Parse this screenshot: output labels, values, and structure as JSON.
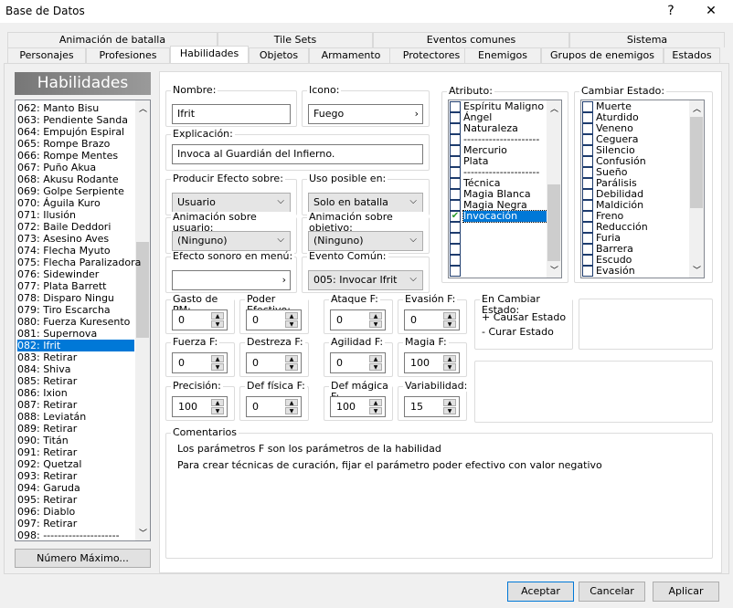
{
  "window": {
    "title": "Base de Datos",
    "help": "?",
    "close": "✕"
  },
  "tabs_row1": [
    "Animación de batalla",
    "Tile Sets",
    "Eventos comunes",
    "Sistema"
  ],
  "tabs_row2": [
    "Personajes",
    "Profesiones",
    "Habilidades",
    "Objetos",
    "Armamento",
    "Protectores",
    "Enemigos",
    "Grupos de enemigos",
    "Estados"
  ],
  "active_tab": "Habilidades",
  "sidebar": {
    "header": "Habilidades",
    "selected": "082: Ifrit",
    "max_button": "Número Máximo...",
    "items": [
      "062: Manto Bisu",
      "063: Pendiente Sanda",
      "064: Empujón Espiral",
      "065: Rompe Brazo",
      "066: Rompe Mentes",
      "067: Puño Akua",
      "068: Akusu Rodante",
      "069: Golpe Serpiente",
      "070: Águila Kuro",
      "071: Ilusión",
      "072: Baile Deddori",
      "073: Asesino Aves",
      "074: Flecha Myuto",
      "075: Flecha Paralizadora",
      "076: Sidewinder",
      "077: Plata Barrett",
      "078: Disparo Ningu",
      "079: Tiro Escarcha",
      "080: Fuerza Kuresento",
      "081: Supernova",
      "082: Ifrit",
      "083: Retirar",
      "084: Shiva",
      "085: Retirar",
      "086: Ixion",
      "087: Retirar",
      "088: Leviatán",
      "089: Retirar",
      "090: Titán",
      "091: Retirar",
      "092: Quetzal",
      "093: Retirar",
      "094: Garuda",
      "095: Retirar",
      "096: Diablo",
      "097: Retirar",
      "098: ---------------------"
    ]
  },
  "form": {
    "nombre": {
      "label": "Nombre:",
      "value": "Ifrit"
    },
    "icono": {
      "label": "Icono:",
      "value": "Fuego"
    },
    "explicacion": {
      "label": "Explicación:",
      "value": "Invoca al Guardián del Infierno."
    },
    "producir": {
      "label": "Producir Efecto sobre:",
      "value": "Usuario"
    },
    "uso": {
      "label": "Uso posible en:",
      "value": "Solo en batalla"
    },
    "anim_usuario": {
      "label": "Animación sobre usuario:",
      "value": "(Ninguno)"
    },
    "anim_objetivo": {
      "label": "Animación sobre objetivo:",
      "value": "(Ninguno)"
    },
    "efecto_sonoro": {
      "label": "Efecto sonoro en menú:",
      "value": ""
    },
    "evento_comun": {
      "label": "Evento Común:",
      "value": "005: Invocar Ifrit"
    },
    "spinners": [
      {
        "label": "Gasto de PM:",
        "value": "0"
      },
      {
        "label": "Poder Efectivo:",
        "value": "0"
      },
      {
        "label": "Ataque F:",
        "value": "0"
      },
      {
        "label": "Evasión F:",
        "value": "0"
      },
      {
        "label": "Fuerza F:",
        "value": "0"
      },
      {
        "label": "Destreza F:",
        "value": "0"
      },
      {
        "label": "Agilidad F:",
        "value": "0"
      },
      {
        "label": "Magia F:",
        "value": "100"
      },
      {
        "label": "Precisión:",
        "value": "100"
      },
      {
        "label": "Def física F:",
        "value": "0"
      },
      {
        "label": "Def mágica F:",
        "value": "100"
      },
      {
        "label": "Variabilidad:",
        "value": "15"
      }
    ],
    "atributo": {
      "label": "Atributo:",
      "items": [
        "Espíritu Maligno",
        "Ángel",
        "Naturaleza",
        "---------------------",
        "Mercurio",
        "Plata",
        "---------------------",
        "Técnica",
        "Magia Blanca",
        "Magia Negra",
        "Invocación",
        "",
        "",
        "",
        "",
        ""
      ],
      "checked": [
        10
      ]
    },
    "estado": {
      "label": "Cambiar Estado:",
      "items": [
        "Muerte",
        "Aturdido",
        "Veneno",
        "Ceguera",
        "Silencio",
        "Confusión",
        "Sueño",
        "Parálisis",
        "Debilidad",
        "Maldición",
        "Freno",
        "Reducción",
        "Furia",
        "Barrera",
        "Escudo",
        "Evasión"
      ]
    },
    "en_cambiar": {
      "label": "En Cambiar Estado:",
      "causar": "+ Causar Estado",
      "curar": "- Curar Estado"
    },
    "comentarios": {
      "label": "Comentarios",
      "lines": [
        "Los parámetros F son los parámetros de la habilidad",
        "Para crear técnicas de curación, fijar el parámetro poder efectivo con valor negativo"
      ]
    }
  },
  "buttons": {
    "ok": "Aceptar",
    "cancel": "Cancelar",
    "apply": "Aplicar"
  }
}
